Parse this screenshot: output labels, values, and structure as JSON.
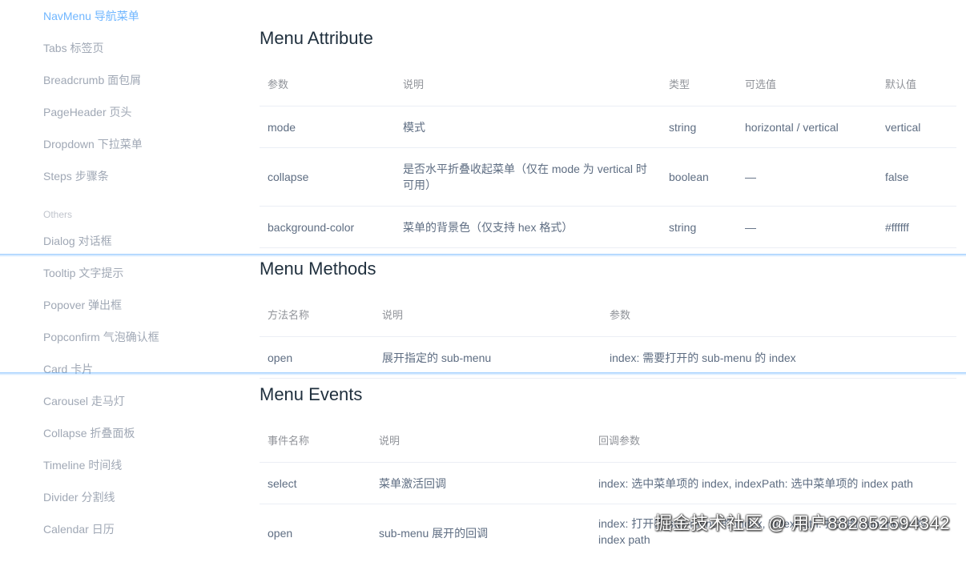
{
  "sidebar": {
    "items": [
      {
        "label": "NavMenu 导航菜单",
        "active": true
      },
      {
        "label": "Tabs 标签页"
      },
      {
        "label": "Breadcrumb 面包屑"
      },
      {
        "label": "PageHeader 页头"
      },
      {
        "label": "Dropdown 下拉菜单"
      },
      {
        "label": "Steps 步骤条"
      }
    ],
    "group_others": "Others",
    "others": [
      {
        "label": "Dialog 对话框"
      },
      {
        "label": "Tooltip 文字提示"
      },
      {
        "label": "Popover 弹出框"
      },
      {
        "label": "Popconfirm 气泡确认框"
      },
      {
        "label": "Card 卡片"
      },
      {
        "label": "Carousel 走马灯"
      },
      {
        "label": "Collapse 折叠面板"
      },
      {
        "label": "Timeline 时间线"
      },
      {
        "label": "Divider 分割线"
      },
      {
        "label": "Calendar 日历"
      }
    ]
  },
  "attributes": {
    "title": "Menu Attribute",
    "headers": [
      "参数",
      "说明",
      "类型",
      "可选值",
      "默认值"
    ],
    "rows": [
      [
        "mode",
        "模式",
        "string",
        "horizontal / vertical",
        "vertical"
      ],
      [
        "collapse",
        "是否水平折叠收起菜单（仅在 mode 为 vertical 时可用）",
        "boolean",
        "—",
        "false"
      ],
      [
        "background-color",
        "菜单的背景色（仅支持 hex 格式）",
        "string",
        "—",
        "#ffffff"
      ]
    ]
  },
  "methods": {
    "title": "Menu Methods",
    "headers": [
      "方法名称",
      "说明",
      "参数"
    ],
    "rows": [
      [
        "open",
        "展开指定的 sub-menu",
        "index: 需要打开的 sub-menu 的 index"
      ]
    ]
  },
  "events": {
    "title": "Menu Events",
    "headers": [
      "事件名称",
      "说明",
      "回调参数"
    ],
    "rows": [
      [
        "select",
        "菜单激活回调",
        "index: 选中菜单项的 index, indexPath: 选中菜单项的 index path"
      ],
      [
        "open",
        "sub-menu 展开的回调",
        "index: 打开的 sub-menu 的 index, indexPath: 打开的 sub-menu 的 index path"
      ]
    ]
  },
  "watermark": "掘金技术社区 @ 用户882852594342"
}
